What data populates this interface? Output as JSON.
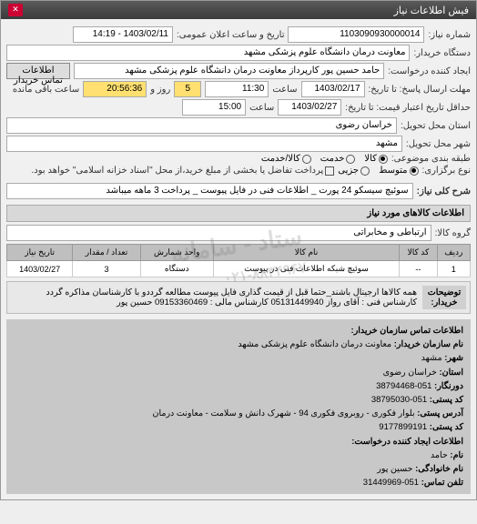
{
  "window": {
    "title": "فیش اطلاعات نیاز"
  },
  "header": {
    "number_label": "شماره نیاز:",
    "number": "1103090930000014",
    "announce_label": "تاریخ و ساعت اعلان عمومی:",
    "announce": "1403/02/11 - 14:19"
  },
  "buyer": {
    "name_label": "دستگاه خریدار:",
    "name": "معاونت درمان دانشگاه علوم پزشکی مشهد",
    "creator_label": "ایجاد کننده درخواست:",
    "creator": "حامد حسین پور کارپرداز معاونت درمان دانشگاه علوم پزشکی مشهد",
    "contact_btn": "اطلاعات تماس خریدار"
  },
  "deadline": {
    "response_label": "مهلت ارسال پاسخ: تا تاریخ:",
    "response_date": "1403/02/17",
    "time_label": "ساعت",
    "response_time": "11:30",
    "day_label": "روز و",
    "days": "5",
    "remain_label": "ساعت باقی مانده",
    "remain_time": "20:56:36",
    "price_label": "حداقل تاریخ اعتبار قیمت: تا تاریخ:",
    "price_date": "1403/02/27",
    "price_time": "15:00"
  },
  "location": {
    "province_label": "استان محل تحویل:",
    "province": "خراسان رضوی",
    "city_label": "شهر محل تحویل:",
    "city": "مشهد"
  },
  "classify": {
    "label": "طبقه بندی موضوعی:",
    "opt_all": "کالا",
    "opt_service": "خدمت",
    "opt_both": "کالا/خدمت"
  },
  "priority": {
    "label": "نوع برگزاری:",
    "opt1": "متوسط",
    "opt2": "جزیی",
    "note": "پرداخت تفاضل یا بخشی از مبلغ خرید،از محل \"اسناد خزانه اسلامی\" خواهد بود."
  },
  "need": {
    "label": "شرح کلی نیاز:",
    "text": "سوئیچ سیسکو 24 پورت _ اطلاعات فنی در فایل پیوست _ پرداخت 3 ماهه میباشد"
  },
  "goods": {
    "title": "اطلاعات کالاهای مورد نیاز",
    "group_label": "گروه کالا:",
    "group": "ارتباطی و مخابراتی"
  },
  "table": {
    "headers": [
      "ردیف",
      "کد کالا",
      "نام کالا",
      "واحد شمارش",
      "تعداد / مقدار",
      "تاریخ نیاز"
    ],
    "rows": [
      {
        "idx": "1",
        "code": "--",
        "name": "سوئیچ شبکه اطلاعات فنی در پیوست",
        "unit": "دستگاه",
        "qty": "3",
        "date": "1403/02/27"
      }
    ]
  },
  "notes": {
    "side": "توضیحات خریدار:",
    "text": "همه کالاها ارجینال باشند_حتما قبل از قیمت گذاری فایل پیوست مطالعه گرددو با کارشناسان مذاکره گردد کارشناس فنی : آقای رواز 05131449940 کارشناس مالی : 09153360469 حسین پور"
  },
  "contacts": {
    "title": "اطلاعات تماس سازمان خریدار:",
    "org_label": "نام سازمان خریدار:",
    "org": "معاونت درمان دانشگاه علوم پزشکی مشهد",
    "city_label": "شهر:",
    "city": "مشهد",
    "province_label": "استان:",
    "province": "خراسان رضوی",
    "fax_label": "دورنگار:",
    "fax": "051-38794468",
    "postal_label": "کد پستی:",
    "postal": "051-38795030",
    "addr_label": "آدرس پستی:",
    "addr": "بلوار فکوری - روبروی فکوری 94 - شهرک دانش و سلامت - معاونت درمان",
    "nat_label": "کد پستی:",
    "nat": "9177899191",
    "sec_title": "اطلاعات ایجاد کننده درخواست:",
    "fname_label": "نام:",
    "fname": "حامد",
    "lname_label": "نام خانوادگی:",
    "lname": "حسین پور",
    "tel_label": "تلفن تماس:",
    "tel": "051-31449969"
  },
  "watermark": "ستاد - سامانه",
  "phone_wm": "۰۲۱-۸۸۳۴۹۶۷"
}
